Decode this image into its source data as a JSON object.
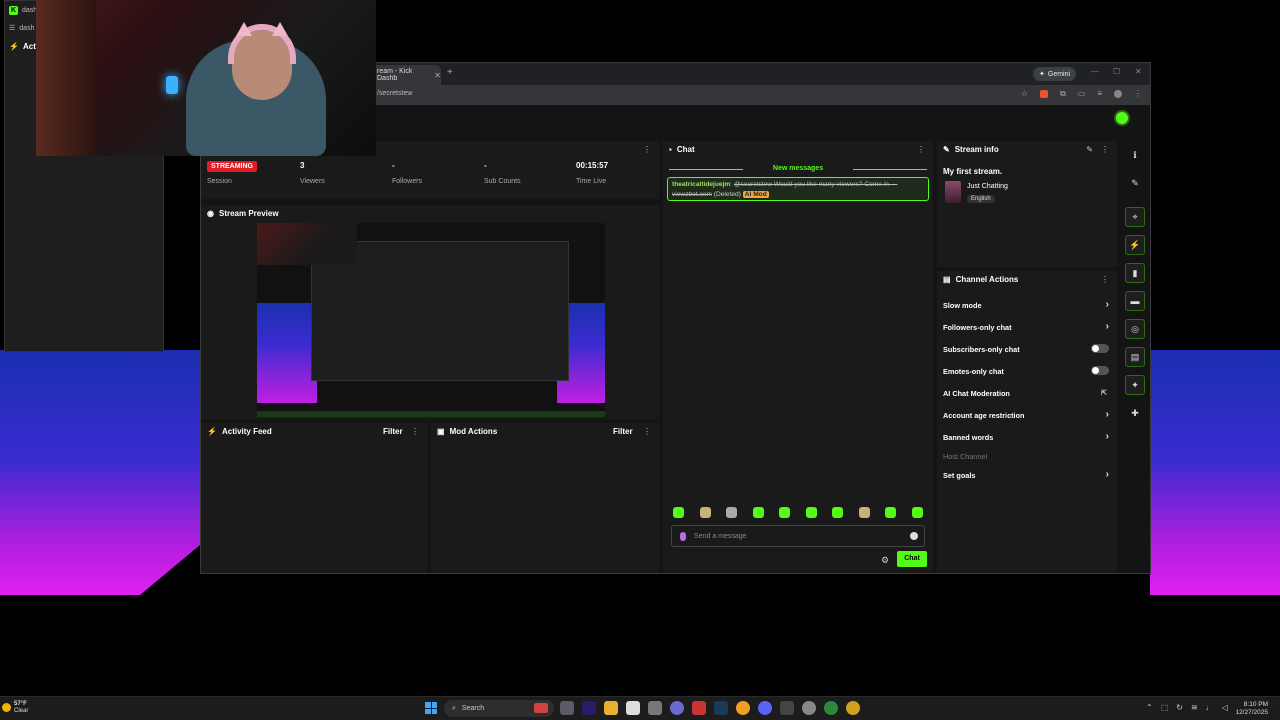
{
  "side_window": {
    "row1": "dashbo",
    "row2": "dash",
    "row3": "Acti"
  },
  "browser": {
    "tab_title": "ream - Kick Dashb",
    "url": "/secretstew",
    "gemini_label": "Gemini"
  },
  "stats": {
    "session_badge": "STREAMING",
    "session_label": "Session",
    "viewers_value": "3",
    "viewers_label": "Viewers",
    "followers_value": "-",
    "followers_label": "Followers",
    "subs_value": "-",
    "subs_label": "Sub Counts",
    "time_value": "00:15:57",
    "time_label": "Time Live"
  },
  "preview": {
    "title": "Stream Preview"
  },
  "activity": {
    "title": "Activity Feed",
    "filter": "Filter"
  },
  "mod": {
    "title": "Mod Actions",
    "filter": "Filter"
  },
  "chat": {
    "title": "Chat",
    "new_messages": "New messages",
    "message": {
      "user": "theatricaltidejuejm",
      "text": "@secretstew Would you like many viewers? Come in — viewzbot.com",
      "deleted": "(Deleted)",
      "badge": "AI Mod"
    },
    "input_placeholder": "Send a message",
    "send_button": "Chat"
  },
  "stream_info": {
    "title": "Stream info",
    "stream_title": "My first stream.",
    "category": "Just Chatting",
    "language": "English"
  },
  "channel_actions": {
    "title": "Channel Actions",
    "items": [
      {
        "label": "Slow mode",
        "control": "chevron"
      },
      {
        "label": "Followers-only chat",
        "control": "chevron"
      },
      {
        "label": "Subscribers-only chat",
        "control": "toggle"
      },
      {
        "label": "Emotes-only chat",
        "control": "toggle"
      },
      {
        "label": "AI Chat Moderation",
        "control": "external"
      },
      {
        "label": "Account age restriction",
        "control": "chevron"
      },
      {
        "label": "Banned words",
        "control": "chevron"
      },
      {
        "label": "Host Channel",
        "control": "none"
      },
      {
        "label": "Set goals",
        "control": "chevron"
      }
    ]
  },
  "taskbar": {
    "temp": "57°F",
    "condition": "Clear",
    "search": "Search",
    "time": "8:10 PM",
    "date": "12/27/2025"
  },
  "colors": {
    "accent": "#53fc18",
    "live": "#e01c25",
    "panel": "#1a1a1b"
  }
}
